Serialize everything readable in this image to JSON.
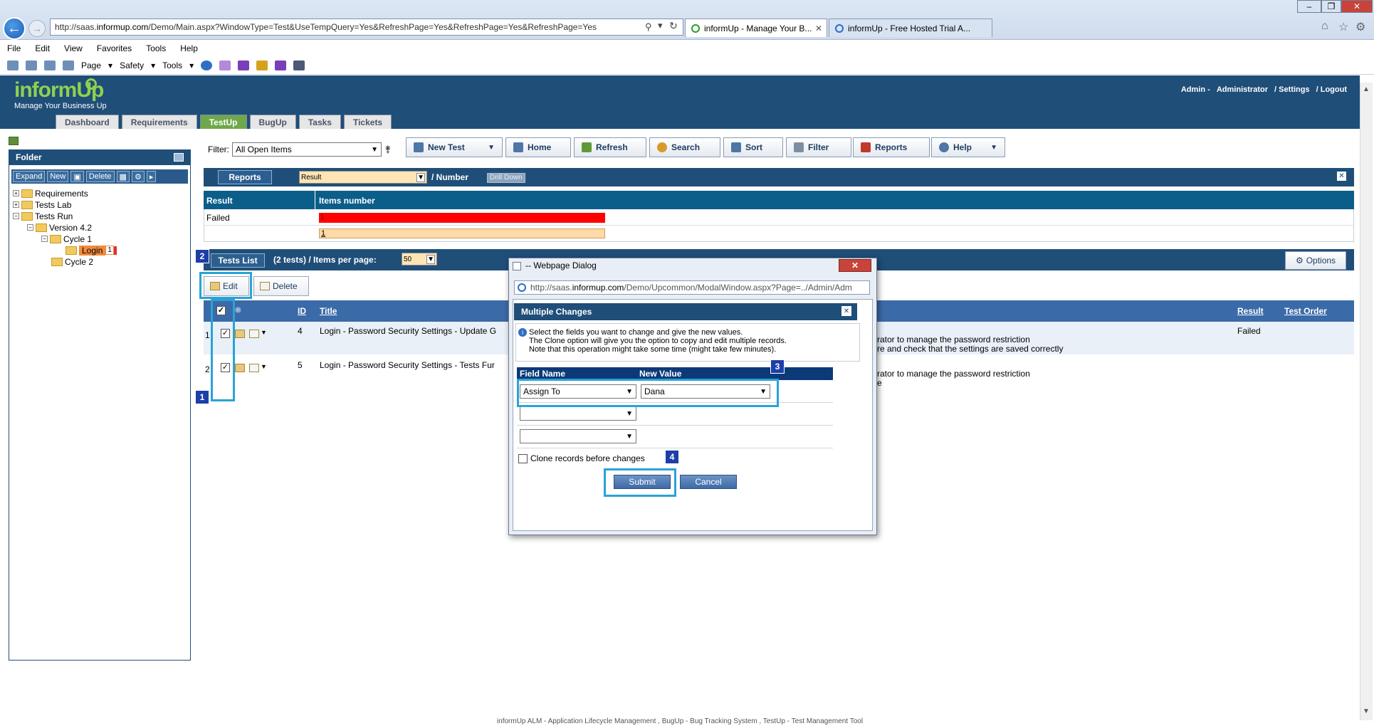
{
  "browser": {
    "url": "http://saas.informup.com/Demo/Main.aspx?WindowType=Test&UseTempQuery=Yes&RefreshPage=Yes&RefreshPage=Yes&RefreshPage=Yes",
    "url_prefix": "http://saas.",
    "url_host": "informup.com",
    "url_rest": "/Demo/Main.aspx?WindowType=Test&UseTempQuery=Yes&RefreshPage=Yes&RefreshPage=Yes&RefreshPage=Yes",
    "tabs": [
      {
        "label": "informUp - Manage Your B...",
        "active": true
      },
      {
        "label": "informUp - Free Hosted Trial A...",
        "active": false
      }
    ],
    "menu": [
      "File",
      "Edit",
      "View",
      "Favorites",
      "Tools",
      "Help"
    ],
    "commands": {
      "page": "Page",
      "safety": "Safety",
      "tools": "Tools"
    },
    "window_controls": {
      "minimize": "–",
      "restore": "❐",
      "close": "✕"
    }
  },
  "app": {
    "logo": "informUp",
    "tagline": "Manage Your Business Up",
    "user": {
      "name": "Admin -",
      "role": "Administrator",
      "settings": "/ Settings",
      "logout": "/ Logout"
    },
    "tabs": [
      {
        "label": "Dashboard",
        "active": false
      },
      {
        "label": "Requirements",
        "active": false
      },
      {
        "label": "TestUp",
        "active": true
      },
      {
        "label": "BugUp",
        "active": false
      },
      {
        "label": "Tasks",
        "active": false
      },
      {
        "label": "Tickets",
        "active": false
      }
    ],
    "colors": {
      "header": "#1f4e79",
      "active_tab": "#6fa84b",
      "logo": "#8fd14f",
      "annotation": "#29a3d6",
      "badge": "#1d3fa8"
    }
  },
  "folder": {
    "title": "Folder",
    "tools": {
      "expand": "Expand",
      "new": "New",
      "delete": "Delete"
    },
    "tree": {
      "requirements": "Requirements",
      "tests_lab": "Tests Lab",
      "tests_run": "Tests Run",
      "version": "Version 4.2",
      "cycle1": "Cycle 1",
      "login": "Login",
      "login_count": "1",
      "cycle2": "Cycle 2"
    }
  },
  "toolbar": {
    "filter_label": "Filter:",
    "filter_value": "All Open Items",
    "new_test": "New Test",
    "home": "Home",
    "refresh": "Refresh",
    "search": "Search",
    "sort": "Sort",
    "filter": "Filter",
    "reports": "Reports",
    "help": "Help"
  },
  "reports": {
    "tab": "Reports",
    "field": "Result",
    "slash_number": "/ Number",
    "drill_down": "Drill Down",
    "col_result": "Result",
    "col_items": "Items number",
    "rows": [
      {
        "result": "Failed",
        "count": "1"
      }
    ],
    "total": "1"
  },
  "tests_list": {
    "tab": "Tests List",
    "count_text": "(2 tests) / Items per page:",
    "per_page": "50",
    "options": "Options",
    "edit": "Edit",
    "delete": "Delete",
    "columns": {
      "id": "ID",
      "title": "Title",
      "result": "Result",
      "test_order": "Test Order"
    },
    "rows": [
      {
        "num": "1",
        "id": "4",
        "title": "Login - Password Security Settings - Update G",
        "desc1": "rator to manage the password restriction",
        "desc2": "re and check that the settings are saved correctly",
        "result": "Failed"
      },
      {
        "num": "2",
        "id": "5",
        "title": "Login - Password Security Settings - Tests Fur",
        "desc1": "rator to manage the password restriction",
        "desc2": "e",
        "result": ""
      }
    ]
  },
  "dialog": {
    "title": "-- Webpage Dialog",
    "url_prefix": "http://saas.",
    "url_host": "informup.com",
    "url_rest": "/Demo/Upcommon/ModalWindow.aspx?Page=../Admin/Adm",
    "panel_title": "Multiple Changes",
    "info_lines": [
      "Select the fields you want to change and give the new values.",
      "The Clone option will give you the option to copy and edit multiple records.",
      "Note that this operation might take some time (might take few minutes)."
    ],
    "col_field": "Field Name",
    "col_value": "New Value",
    "row1_field": "Assign To",
    "row1_value": "Dana",
    "clone_label": "Clone records before changes",
    "submit": "Submit",
    "cancel": "Cancel"
  },
  "annotations": {
    "b1": "1",
    "b2": "2",
    "b3": "3",
    "b4": "4"
  },
  "footer": "informUp ALM - Application Lifecycle Management , BugUp - Bug Tracking System , TestUp - Test Management Tool"
}
